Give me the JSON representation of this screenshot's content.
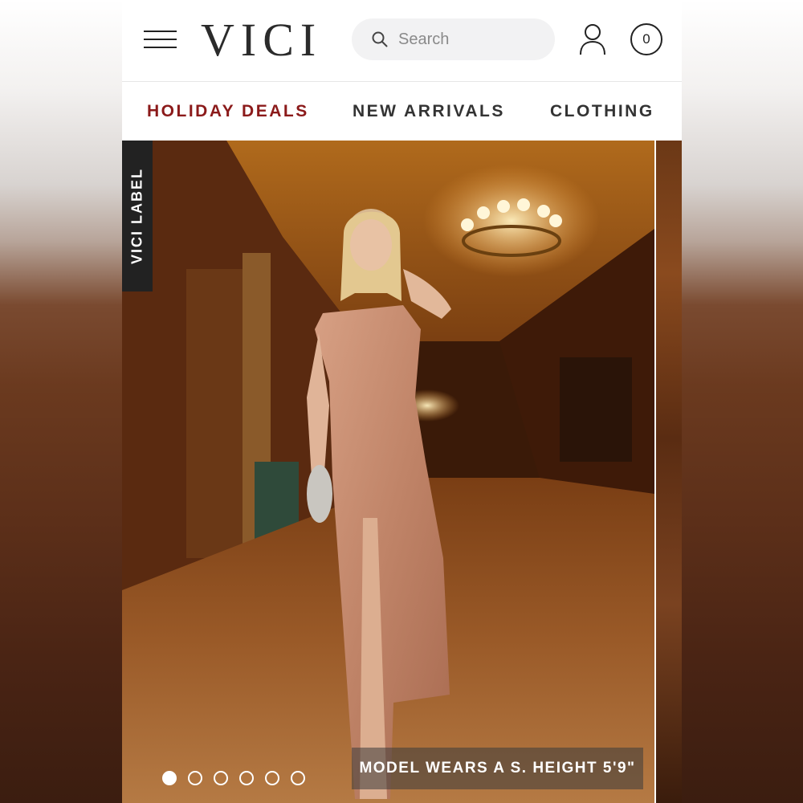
{
  "header": {
    "logo": "VICI",
    "search_placeholder": "Search",
    "cart_count": "0"
  },
  "nav": {
    "items": [
      {
        "label": "HOLIDAY DEALS"
      },
      {
        "label": "NEW ARRIVALS"
      },
      {
        "label": "CLOTHING"
      }
    ]
  },
  "hero": {
    "badge": "VICI LABEL",
    "caption": "MODEL WEARS A S. HEIGHT 5'9\"",
    "slide_count": 6,
    "active_slide": 1
  },
  "colors": {
    "accent": "#8b1a1a",
    "text": "#333333"
  }
}
